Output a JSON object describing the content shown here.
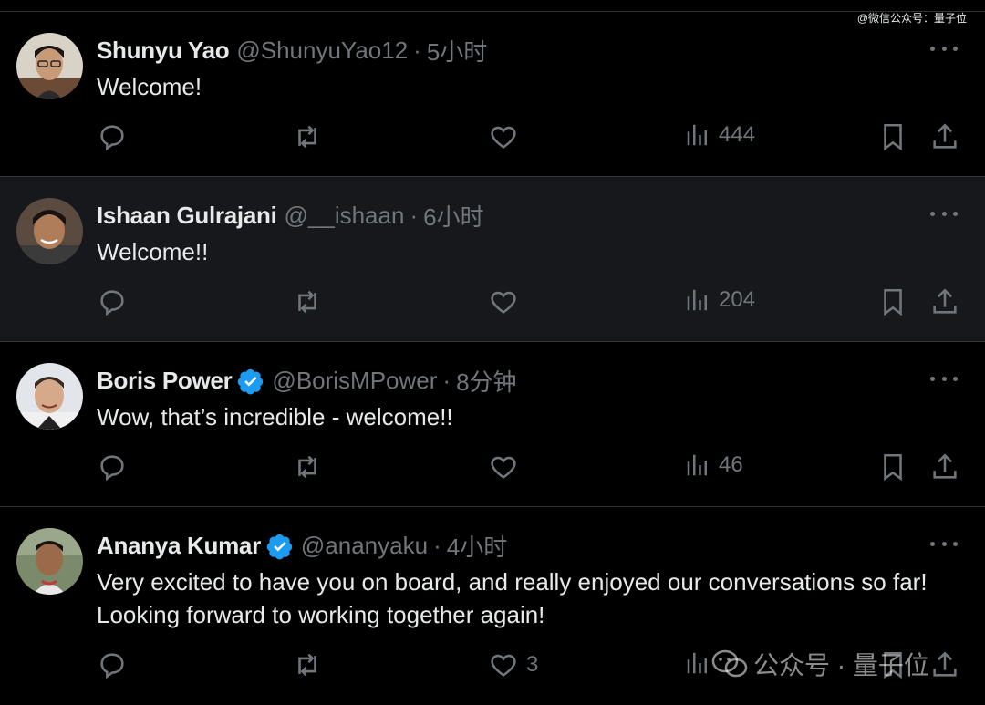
{
  "watermark_top": "@微信公众号：量子位",
  "watermark_bottom": "公众号 · 量子位",
  "colors": {
    "background": "#000000",
    "highlight": "#16181c",
    "divider": "#2f3336",
    "muted": "#71767b",
    "text": "#e7e9ea",
    "verified": "#1d9bf0"
  },
  "tweets": [
    {
      "name": "Shunyu Yao",
      "verified": false,
      "handle": "@ShunyuYao12",
      "dot": "·",
      "time": "5小时",
      "text": "Welcome!",
      "reply_count": "",
      "retweet_count": "",
      "like_count": "",
      "views": "444",
      "icons": [
        "reply-icon",
        "retweet-icon",
        "like-icon",
        "views-icon",
        "bookmark-icon",
        "share-icon"
      ]
    },
    {
      "name": "Ishaan Gulrajani",
      "verified": false,
      "handle": "@__ishaan",
      "dot": "·",
      "time": "6小时",
      "text": "Welcome!!",
      "reply_count": "",
      "retweet_count": "",
      "like_count": "",
      "views": "204"
    },
    {
      "name": "Boris Power",
      "verified": true,
      "handle": "@BorisMPower",
      "dot": "·",
      "time": "8分钟",
      "text": "Wow, that’s incredible - welcome!!",
      "reply_count": "",
      "retweet_count": "",
      "like_count": "",
      "views": "46"
    },
    {
      "name": "Ananya Kumar",
      "verified": true,
      "handle": "@ananyaku",
      "dot": "·",
      "time": "4小时",
      "text": "Very excited to have you on board, and really enjoyed our conversations so far! Looking forward to working together again!",
      "reply_count": "",
      "retweet_count": "",
      "like_count": "3",
      "views": ""
    }
  ]
}
